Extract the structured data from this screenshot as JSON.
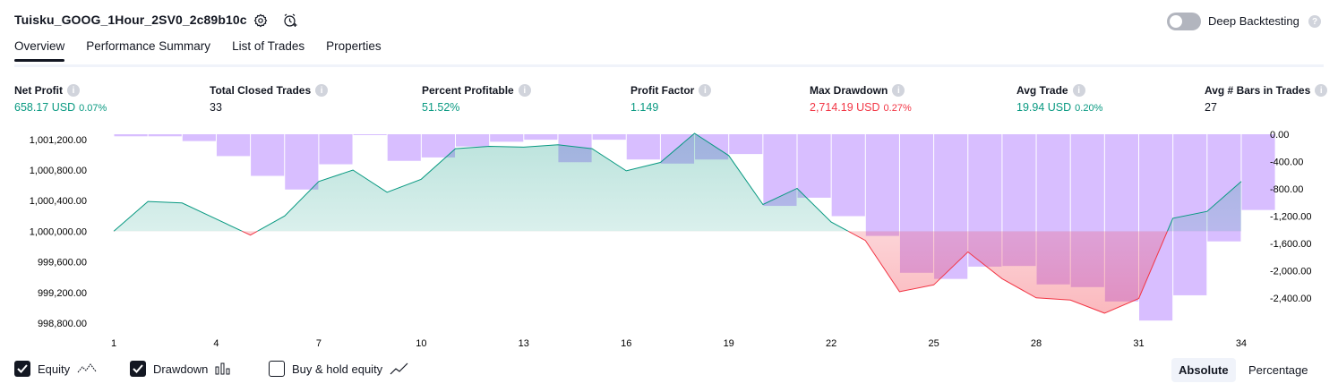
{
  "header": {
    "title": "Tuisku_GOOG_1Hour_2SV0_2c89b10c",
    "deep_backtesting_label": "Deep Backtesting",
    "deep_backtesting_enabled": false
  },
  "tabs": [
    {
      "label": "Overview",
      "active": true
    },
    {
      "label": "Performance Summary",
      "active": false
    },
    {
      "label": "List of Trades",
      "active": false
    },
    {
      "label": "Properties",
      "active": false
    }
  ],
  "metrics": [
    {
      "label": "Net Profit",
      "value": "658.17 USD",
      "percent": "0.07%",
      "color": "green"
    },
    {
      "label": "Total Closed Trades",
      "value": "33",
      "percent": "",
      "color": "default"
    },
    {
      "label": "Percent Profitable",
      "value": "51.52%",
      "percent": "",
      "color": "green"
    },
    {
      "label": "Profit Factor",
      "value": "1.149",
      "percent": "",
      "color": "green"
    },
    {
      "label": "Max Drawdown",
      "value": "2,714.19 USD",
      "percent": "0.27%",
      "color": "red"
    },
    {
      "label": "Avg Trade",
      "value": "19.94 USD",
      "percent": "0.20%",
      "color": "green"
    },
    {
      "label": "Avg # Bars in Trades",
      "value": "27",
      "percent": "",
      "color": "default"
    }
  ],
  "chart_data": {
    "type": "line",
    "x": [
      1,
      2,
      3,
      4,
      5,
      6,
      7,
      8,
      9,
      10,
      11,
      12,
      13,
      14,
      15,
      16,
      17,
      18,
      19,
      20,
      21,
      22,
      23,
      24,
      25,
      26,
      27,
      28,
      29,
      30,
      31,
      32,
      33,
      34
    ],
    "x_ticks": [
      "1",
      "4",
      "7",
      "10",
      "13",
      "16",
      "19",
      "22",
      "25",
      "28",
      "31",
      "34"
    ],
    "left_axis": {
      "ticks": [
        "1,001,200.00",
        "1,000,800.00",
        "1,000,400.00",
        "1,000,000.00",
        "999,600.00",
        "999,200.00",
        "998,800.00"
      ],
      "range": [
        998700,
        1001300
      ]
    },
    "right_axis": {
      "ticks": [
        "0.00",
        "-400.00",
        "-800.00",
        "-1,200.00",
        "-1,600.00",
        "-2,000.00",
        "-2,400.00"
      ],
      "range": [
        -2760,
        0
      ]
    },
    "baseline": 1000000,
    "series": [
      {
        "name": "Equity",
        "color_up": "#089981",
        "color_down": "#f23645",
        "values": [
          1000000,
          1000390,
          1000370,
          1000160,
          999950,
          1000200,
          1000650,
          1000800,
          1000510,
          1000680,
          1001080,
          1001110,
          1001100,
          1001130,
          1001080,
          1000790,
          1000900,
          1001280,
          1000990,
          1000350,
          1000560,
          1000120,
          999880,
          999210,
          999300,
          999730,
          999380,
          999130,
          999100,
          998930,
          999120,
          1000170,
          1000260,
          1000650
        ]
      },
      {
        "name": "Drawdown",
        "color": "#d1b3ff",
        "values": [
          -30,
          -30,
          -100,
          -320,
          -610,
          -810,
          -440,
          0,
          -390,
          -340,
          -180,
          -110,
          -80,
          -410,
          -80,
          -370,
          -430,
          -370,
          -290,
          -1050,
          -930,
          -1200,
          -1490,
          -2030,
          -2120,
          -1940,
          -1930,
          -2200,
          -2240,
          -2450,
          -2730,
          -2360,
          -1570,
          -1110
        ]
      }
    ]
  },
  "legend": [
    {
      "label": "Equity",
      "checked": true,
      "icon": "equity-line-icon"
    },
    {
      "label": "Drawdown",
      "checked": true,
      "icon": "bars-icon"
    },
    {
      "label": "Buy & hold equity",
      "checked": false,
      "icon": "trend-line-icon"
    }
  ],
  "view_modes": [
    {
      "label": "Absolute",
      "active": true
    },
    {
      "label": "Percentage",
      "active": false
    }
  ]
}
